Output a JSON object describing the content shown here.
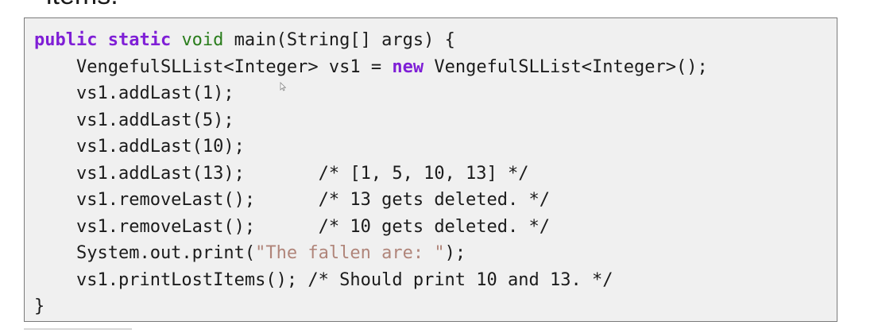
{
  "header": {
    "partial_text": "items."
  },
  "code": {
    "lines": [
      {
        "parts": [
          {
            "t": "public static",
            "c": "kw"
          },
          {
            "t": " "
          },
          {
            "t": "void",
            "c": "type"
          },
          {
            "t": " main(String[] args) {"
          }
        ]
      },
      {
        "parts": [
          {
            "t": "    VengefulSLList<Integer> vs1 = "
          },
          {
            "t": "new",
            "c": "kw"
          },
          {
            "t": " VengefulSLList<Integer>();"
          }
        ]
      },
      {
        "parts": [
          {
            "t": "    vs1.addLast(1);"
          }
        ]
      },
      {
        "parts": [
          {
            "t": "    vs1.addLast(5);"
          }
        ]
      },
      {
        "parts": [
          {
            "t": "    vs1.addLast(10);"
          }
        ]
      },
      {
        "parts": [
          {
            "t": "    vs1.addLast(13);       /* [1, 5, 10, 13] */"
          }
        ]
      },
      {
        "parts": [
          {
            "t": "    vs1.removeLast();      /* 13 gets deleted. */"
          }
        ]
      },
      {
        "parts": [
          {
            "t": "    vs1.removeLast();      /* 10 gets deleted. */"
          }
        ]
      },
      {
        "parts": [
          {
            "t": "    System.out.print("
          },
          {
            "t": "\"The fallen are: \"",
            "c": "str"
          },
          {
            "t": ");"
          }
        ]
      },
      {
        "parts": [
          {
            "t": "    vs1.printLostItems(); /* Should print 10 and 13. */"
          }
        ]
      },
      {
        "parts": [
          {
            "t": "}"
          }
        ]
      }
    ]
  },
  "colors": {
    "keyword": "#7f1fd6",
    "type": "#2a7d1c",
    "string": "#b0857a",
    "box_background": "#f0f0f0"
  },
  "icons": {
    "cursor": "mouse-pointer-icon"
  }
}
